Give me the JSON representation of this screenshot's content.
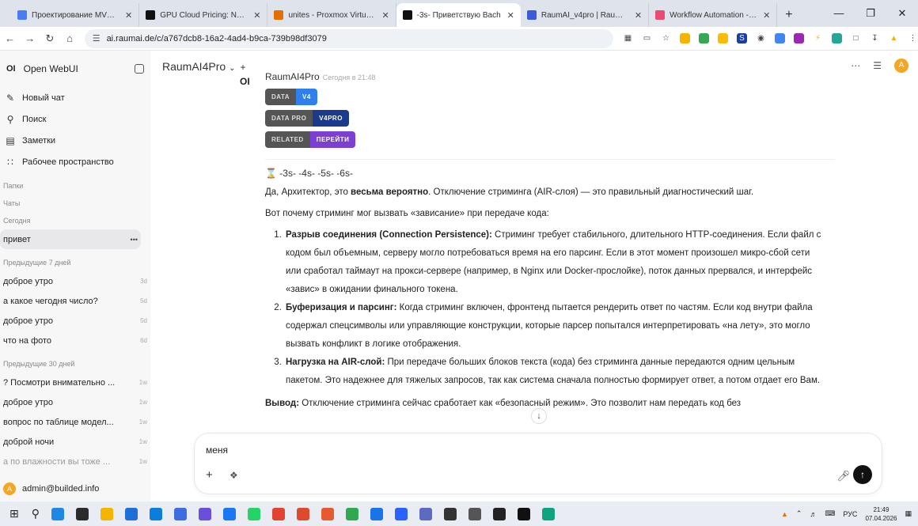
{
  "browser": {
    "tabs": [
      {
        "title": "Проектирование MVP Bu",
        "color": "#4a7cf6"
      },
      {
        "title": "GPU Cloud Pricing: NVIDIA",
        "color": "#111111"
      },
      {
        "title": "unites - Proxmox Virtual E",
        "color": "#e57000"
      },
      {
        "title": "-3s- Приветствую Bach",
        "color": "#111111",
        "active": true
      },
      {
        "title": "RaumAI_v4pro | RaumAI_v",
        "color": "#3b5bdb"
      },
      {
        "title": "Workflow Automation - n8",
        "color": "#ea4b71"
      }
    ],
    "url": "ai.raumai.de/c/a767dcb8-16a2-4ad4-b9ca-739b98df3079"
  },
  "sidebar": {
    "app_name": "Open WebUI",
    "logo": "OI",
    "nav": [
      {
        "label": "Новый чат",
        "icon": "edit-icon"
      },
      {
        "label": "Поиск",
        "icon": "search-icon"
      },
      {
        "label": "Заметки",
        "icon": "notes-icon"
      },
      {
        "label": "Рабочее пространство",
        "icon": "workspace-icon"
      }
    ],
    "folders_label": "Папки",
    "chats_label": "Чаты",
    "today_label": "Сегодня",
    "today": [
      {
        "title": "привет",
        "menu": "•••"
      }
    ],
    "prev7_label": "Предыдущие 7 дней",
    "prev7": [
      {
        "title": "доброе утро",
        "age": "3d"
      },
      {
        "title": "а какое чегодня число?",
        "age": "5d"
      },
      {
        "title": "доброе утро",
        "age": "5d"
      },
      {
        "title": "что на фото",
        "age": "6d"
      }
    ],
    "prev30_label": "Предыдущие 30 дней",
    "prev30": [
      {
        "title": "? Посмотри внимательно ...",
        "age": "1w"
      },
      {
        "title": "доброе утро",
        "age": "1w"
      },
      {
        "title": "вопрос по таблице модел...",
        "age": "1w"
      },
      {
        "title": "доброй ночи",
        "age": "1w"
      },
      {
        "title": "а по влажности вы тоже ...",
        "age": "1w"
      }
    ],
    "user": {
      "email": "admin@builded.info",
      "initial": "A"
    }
  },
  "main": {
    "model_name": "RaumAI4Pro",
    "avatar_initial": "A",
    "assistant_logo": "OI",
    "message": {
      "sender": "RaumAI4Pro",
      "time": "Сегодня в 21:48",
      "badges": [
        {
          "left": "DATA",
          "right": "V4",
          "color": "#2f80ed"
        },
        {
          "left": "DATA PRO",
          "right": "V4PRO",
          "color": "#1b3a8c"
        },
        {
          "left": "RELATED",
          "right": "ПЕРЕЙТИ",
          "color": "#7b3fd1"
        }
      ],
      "stream": "-3s- -4s- -5s- -6s-",
      "intro_pre": "Да, Архитектор, это ",
      "intro_bold": "весьма вероятно",
      "intro_post": ". Отключение стриминга (AIR-слоя) — это правильный диагностический шаг.",
      "lead": "Вот почему стриминг мог вызвать «зависание» при передаче кода:",
      "items": [
        {
          "bold": "Разрыв соединения (Connection Persistence):",
          "text": " Стриминг требует стабильного, длительного HTTP-соединения. Если файл с кодом был объемным, серверу могло потребоваться время на его парсинг. Если в этот момент произошел микро-сбой сети или сработал таймаут на прокси-сервере (например, в Nginx или Docker-прослойке), поток данных прервался, и интерфейс «завис» в ожидании финального токена."
        },
        {
          "bold": "Буферизация и парсинг:",
          "text": " Когда стриминг включен, фронтенд пытается рендерить ответ по частям. Если код внутри файла содержал спецсимволы или управляющие конструкции, которые парсер попытался интерпретировать «на лету», это могло вызвать конфликт в логике отображения."
        },
        {
          "bold": "Нагрузка на AIR-слой:",
          "text": " При передаче больших блоков текста (кода) без стриминга данные передаются одним цельным пакетом. Это надежнее для тяжелых запросов, так как система сначала полностью формирует ответ, а потом отдает его Вам."
        }
      ],
      "conclusion_bold": "Вывод:",
      "conclusion_text": " Отключение стриминга сейчас сработает как «безопасный режим». Это позволит нам передать код без"
    },
    "input_value": "меня"
  },
  "taskbar": {
    "lang": "РУС",
    "time": "21:49",
    "date": "07.04.2026",
    "icons": [
      "#1e88e5",
      "#2b2b2b",
      "#f4b400",
      "#1e6fd9",
      "#0b7dda",
      "#3c6ee0",
      "#6a4fd8",
      "#1877f2",
      "#25d366",
      "#e0432f",
      "#de4a2d",
      "#e55b2d",
      "#2fa84f",
      "#1a73e8",
      "#2962ff",
      "#5c6bc0",
      "#333333",
      "#555555",
      "#222222",
      "#111111",
      "#10a37f"
    ]
  }
}
